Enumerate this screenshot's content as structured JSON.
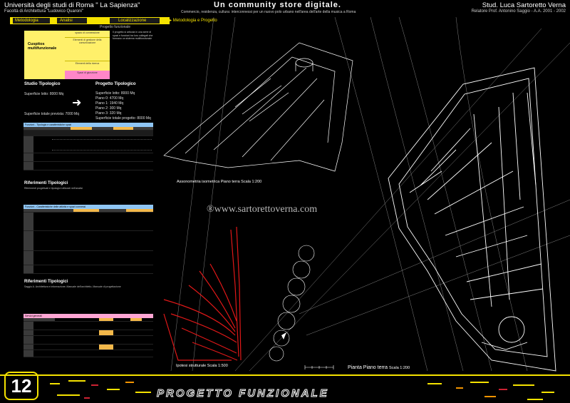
{
  "header": {
    "university": "Università degli studi di Roma \" La Sapienza\"",
    "faculty": "Facoltà di Architettura \"Ludovico Quaroni\"",
    "title": "Un community store digitale.",
    "subtitle": "Commercio, residenza, cultura: interconnessi per un nuovo polo urbano nell'area dell'arte della musica a Roma",
    "student": "Stud. Luca Sartoretto Verna",
    "relatore": "Relatore Prof. Antonino Saggio - A.A. 2001 - 2002"
  },
  "nav": {
    "items": [
      "Metodologia",
      "Analisi",
      "Localizzazione",
      "Metodologia e Progetto"
    ],
    "sub": "Progetto funzionale"
  },
  "legend": {
    "title": "Cuspitos multifunzionale",
    "cells": [
      "spazio di connessione",
      "Elementi di gestione della comunicazione",
      "Elementi della ricerca",
      "Spazi di giunzione"
    ],
    "notes": "Il progetto si articola in una serie di spazi e funzioni tra loro collegati che formano un sistema multifunzionale"
  },
  "studio": {
    "left_title": "Studio Tipologico",
    "left_lines": [
      "Superficie lotto: 8000 Mq",
      "Superficie totale prevista: 7000 Mq"
    ],
    "right_title": "Progetto Tipologico",
    "right_lines": [
      "Superficie lotto: 8000 Mq",
      "Piano 0: 4700 Mq",
      "Piano 1: 1940 Mq",
      "Piano 2: 300 Mq",
      "Piano 3: 320 Mq",
      "Superficie totale progetto: 8000 Mq"
    ]
  },
  "tables": [
    {
      "header": "Funzioni - Tipologia e caratteristiche spazi"
    },
    {
      "header": "Funzioni - Caratteristiche delle attività e spazi connessi"
    },
    {
      "header": "Servizi generali"
    }
  ],
  "refs": [
    {
      "title": "Riferimenti Tipologici",
      "body": "Riferimenti progettuali e tipologici utilizzati nell'analisi"
    },
    {
      "title": "Riferimenti Tipologici",
      "body": "Saggio A. Architettura e informazione; Manuale dell'architetto, Manuale di progettazione"
    }
  ],
  "drawings": {
    "axon_caption": "Assonometria isometrica Piano terra Scala 1:200",
    "struct_caption": "Ipotesi strutturale Scala 1:500",
    "plan_caption": "Pianta Piano terra",
    "plan_scale": "Scala 1:200",
    "watermark": "®www.sartorettoverna.com"
  },
  "footer": {
    "page_number": "12",
    "page_title": "PROGETTO FUNZIONALE"
  },
  "colors": {
    "accent_yellow": "#f5e200",
    "table_blue": "#8fc6f5",
    "table_pink": "#ffa6d4",
    "table_orange": "#f3b84a",
    "struct_red": "#e01818"
  }
}
